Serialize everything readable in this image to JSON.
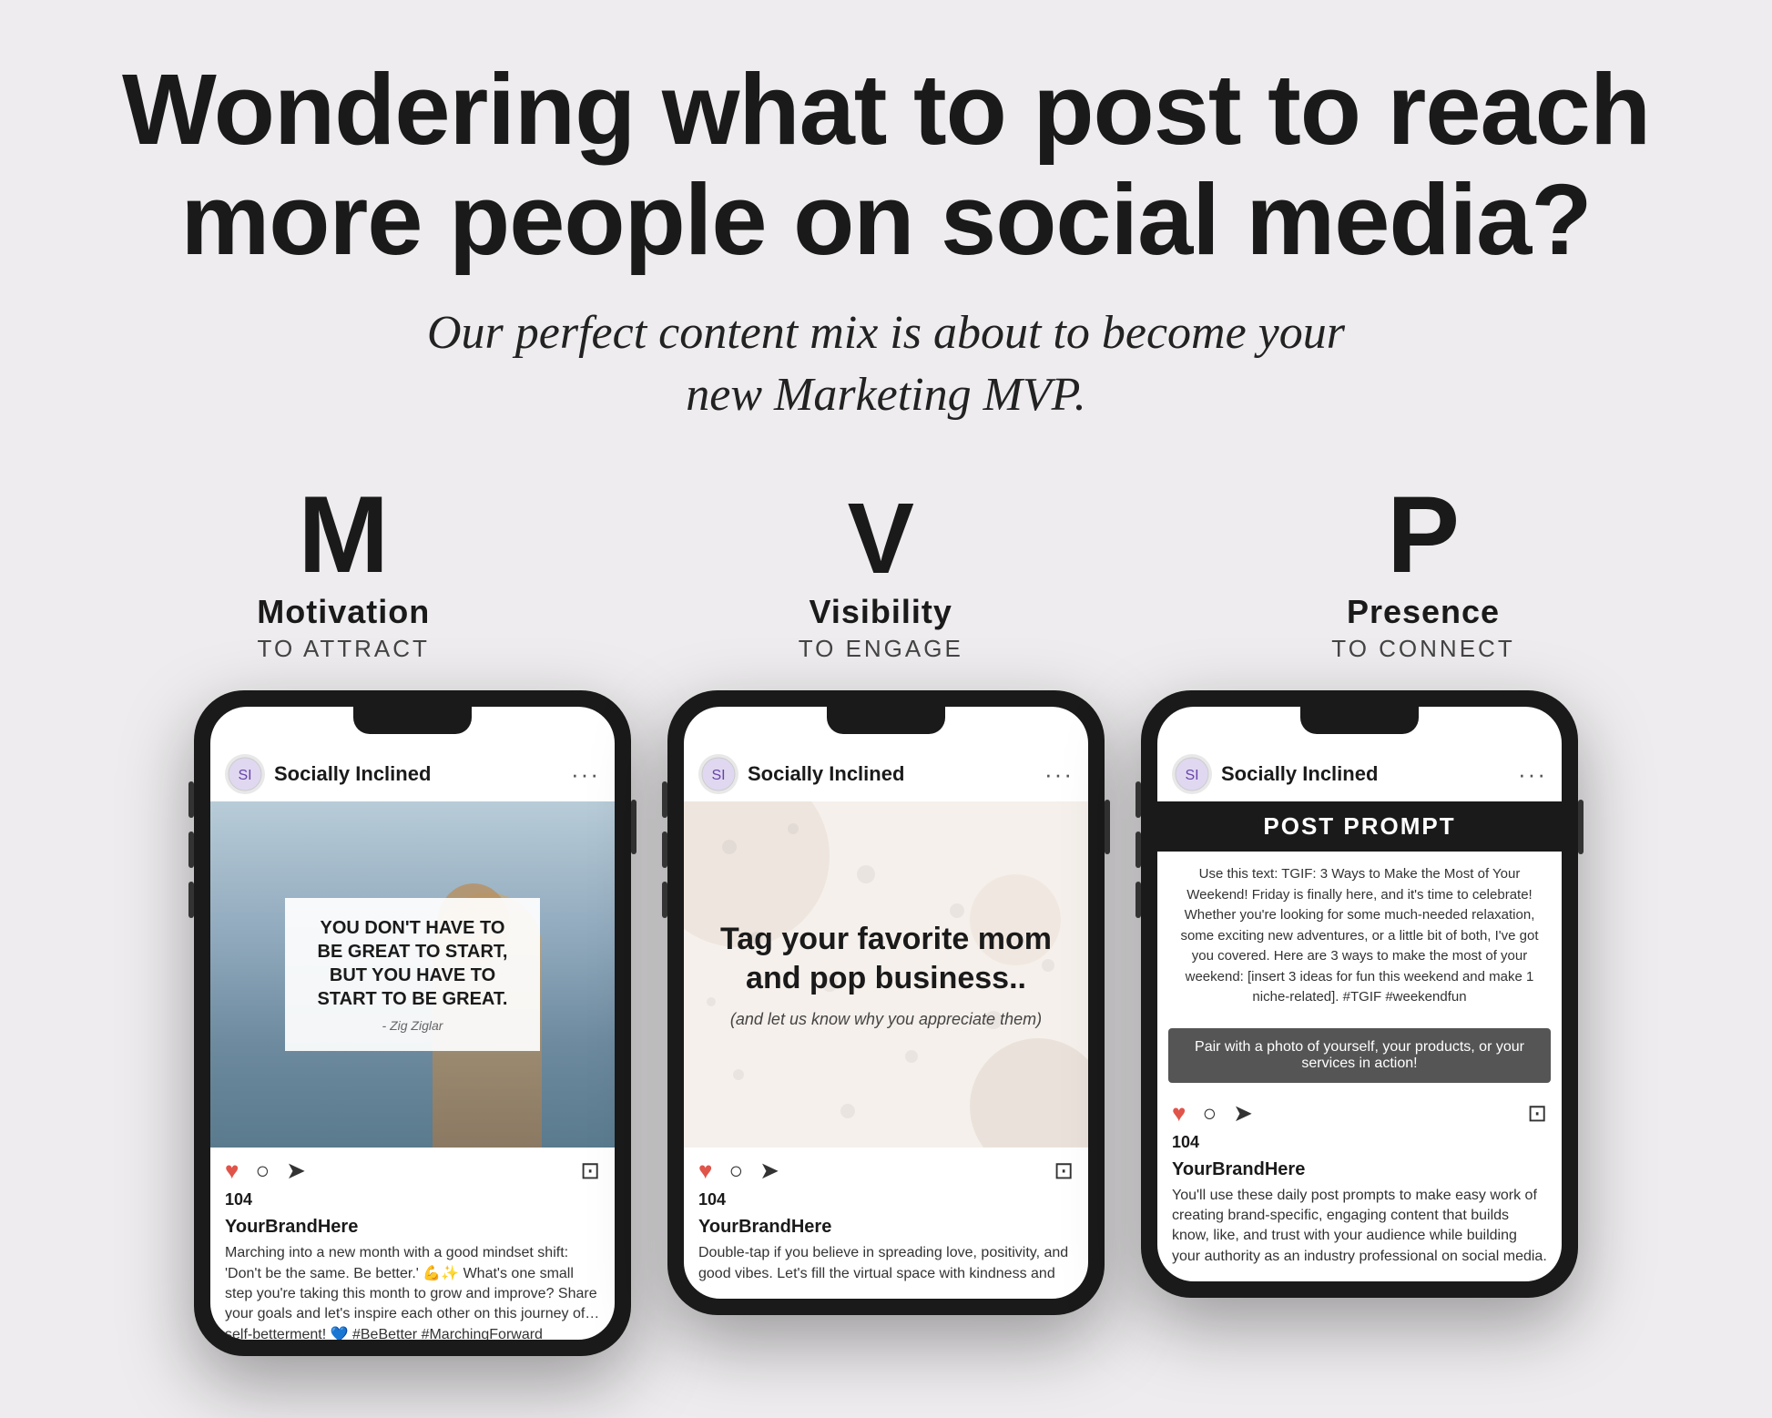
{
  "headline": "Wondering what to post to reach more people on social media?",
  "subheadline": "Our perfect content mix is about to become your new Marketing MVP.",
  "mvp": {
    "m": {
      "letter": "M",
      "name": "Motivation",
      "sub": "TO ATTRACT"
    },
    "v": {
      "letter": "V",
      "name": "Visibility",
      "sub": "TO ENGAGE"
    },
    "p": {
      "letter": "P",
      "name": "Presence",
      "sub": "TO CONNECT"
    }
  },
  "phones": {
    "phone1": {
      "username": "Socially Inclined",
      "quote": "YOU DON'T HAVE TO BE GREAT TO START, BUT YOU HAVE TO START TO BE GREAT.",
      "quote_author": "- Zig Ziglar",
      "likes": "104",
      "brand": "YourBrandHere",
      "caption": "Marching into a new month with a good mindset shift: 'Don't be the same. Be better.' 💪✨ What's one small step you're taking this month to grow and improve? Share your goals and let's inspire each other on this journey of self-betterment! 💙 #BeBetter #MarchingForward"
    },
    "phone2": {
      "username": "Socially Inclined",
      "main_text": "Tag your favorite mom and pop business..",
      "sub_text": "(and let us know why you appreciate them)",
      "likes": "104",
      "brand": "YourBrandHere",
      "caption": "Double-tap if you believe in spreading love, positivity, and good vibes. Let's fill the virtual space with kindness and"
    },
    "phone3": {
      "username": "Socially Inclined",
      "prompt_header": "POST PROMPT",
      "prompt_body": "Use this text: TGIF: 3 Ways to Make the Most of Your Weekend! Friday is finally here, and it's time to celebrate! Whether you're looking for some much-needed relaxation, some exciting new adventures, or a little bit of both, I've got you covered. Here are 3 ways to make the most of your weekend: [insert 3 ideas for fun this weekend and make 1 niche-related]. #TGIF #weekendfun",
      "cta": "Pair with a photo of yourself, your products, or your services in action!",
      "likes": "104",
      "brand": "YourBrandHere",
      "caption": "You'll use these daily post prompts to make easy work of creating brand-specific, engaging content that builds know, like, and trust with your audience while building your authority as an industry professional on social media."
    }
  }
}
